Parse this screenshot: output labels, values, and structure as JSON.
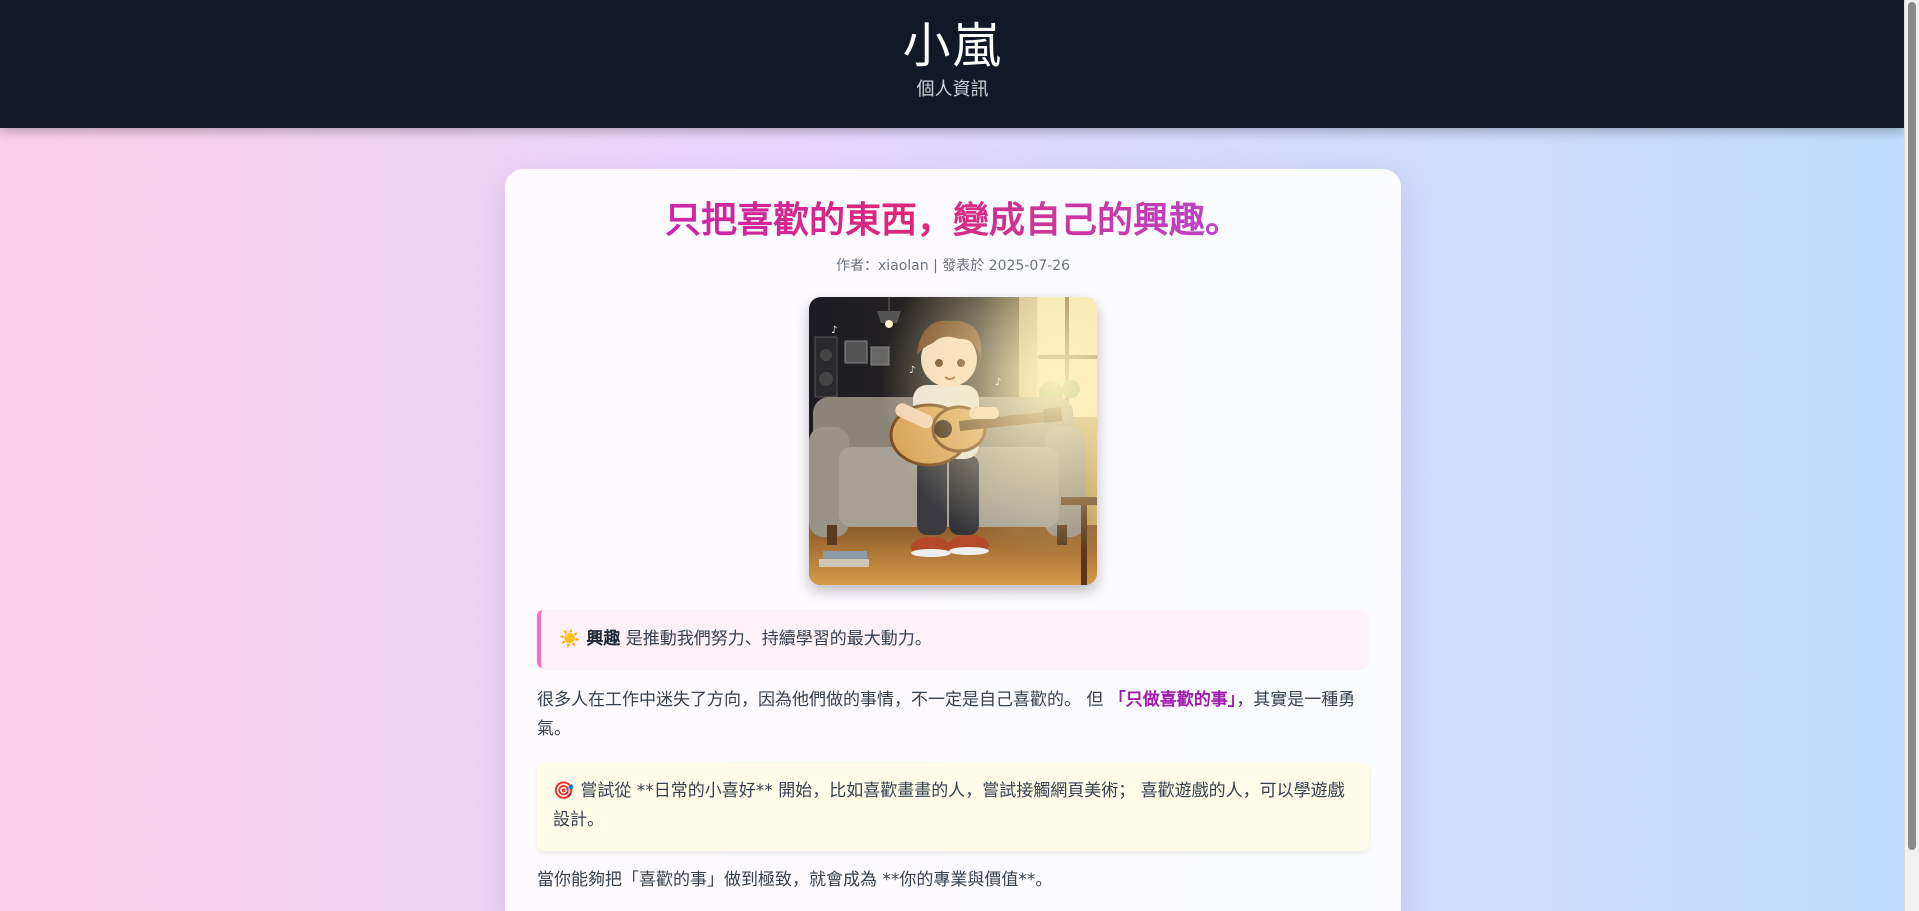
{
  "header": {
    "site_title": "小嵐",
    "site_subtitle": "個人資訊"
  },
  "post": {
    "title": "只把喜歡的東西，變成自己的興趣。",
    "meta": "作者：xiaolan | 發表於 2025-07-26",
    "hero_image_alt": "anime boy playing acoustic guitar on a sofa",
    "callout1": {
      "icon": "sun-icon",
      "icon_glyph": "☀️",
      "bold": "興趣",
      "text": " 是推動我們努力、持續學習的最大動力。"
    },
    "paragraph1": {
      "before": "很多人在工作中迷失了方向，因為他們做的事情，不一定是自己喜歡的。 但 ",
      "highlight": "「只做喜歡的事」",
      "after": "，其實是一種勇氣。"
    },
    "callout2": {
      "icon": "target-icon",
      "icon_glyph": "🎯",
      "text": " 嘗試從 **日常的小喜好** 開始，比如喜歡畫畫的人，嘗試接觸網頁美術； 喜歡遊戲的人，可以學遊戲設計。"
    },
    "paragraph2": "當你能夠把「喜歡的事」做到極致，就會成為 **你的專業與價值**。"
  },
  "colors": {
    "header_bg": "#111827",
    "title_gradient_start": "#c026d3",
    "title_gradient_end": "#a855f7",
    "highlight": "#a21caf",
    "callout_pink_border": "#f472b6",
    "callout_yellow_bg": "#fefce8"
  }
}
